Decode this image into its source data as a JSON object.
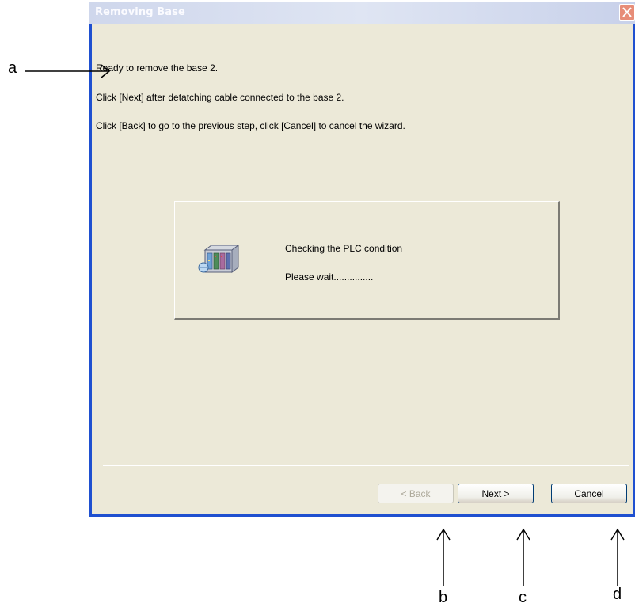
{
  "window": {
    "title": "Removing Base",
    "message_lines": [
      "Ready to remove the base 2.",
      "Click [Next] after detatching cable connected to the base 2.",
      "Click [Back] to go to the previous step, click [Cancel] to cancel the wizard."
    ],
    "status_panel": {
      "line1": "Checking the PLC condition",
      "line2": "Please wait..............."
    },
    "buttons": {
      "back": "< Back",
      "next": "Next >",
      "cancel": "Cancel"
    }
  },
  "callouts": {
    "a": "a",
    "b": "b",
    "c": "c",
    "d": "d"
  },
  "colors": {
    "title_bar": "#cfd7ec",
    "dialog_bg": "#ece9d8",
    "close_button": "#e78d78"
  }
}
